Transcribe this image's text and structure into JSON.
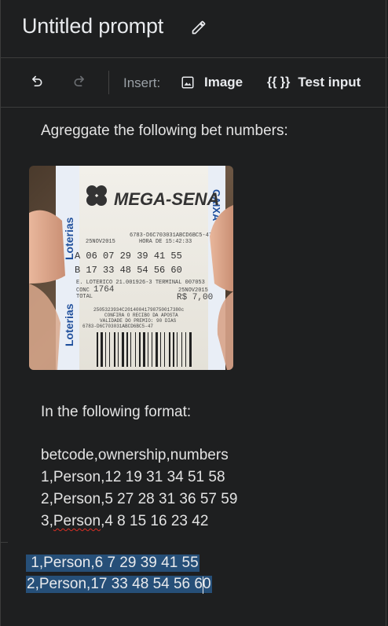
{
  "header": {
    "title": "Untitled prompt",
    "edit_icon": "pencil-icon"
  },
  "toolbar": {
    "undo_icon": "undo-icon",
    "redo_icon": "redo-icon",
    "insert_label": "Insert:",
    "image_label": "Image",
    "image_icon": "image-icon",
    "test_input_braces": "{{ }}",
    "test_input_label": "Test input"
  },
  "prompt": {
    "intro": "Agreggate the following bet numbers:",
    "format_intro": "In the following format:",
    "format_header": "betcode,ownership,numbers",
    "examples": [
      {
        "code": "1,",
        "owner": "Person",
        "rest": ",12 19 31 34 51 58"
      },
      {
        "code": "2,",
        "owner": "Person",
        "rest": ",5 27 28 31 36 57 59"
      },
      {
        "code": "3,",
        "owner": "Person",
        "rest": ",4 8 15 16 23 42"
      }
    ],
    "selected_lines": [
      " 1,Person,6 7 29 39 41 55",
      "2,Person,17 33 48 54 56 60"
    ]
  },
  "ticket": {
    "brand": "MEGA-SENA",
    "side_text": "Loterias",
    "caixa_text": "CAIXA",
    "date": "25NOV2015",
    "hour": "HORA DE 15:42:33",
    "serial": "6783-D6C703031ABCD6BC5-47",
    "line_a": "A  06 07 29 39 41 55",
    "line_b": "B  17 33 48 54 56 60",
    "lotterico": "E. LOTERICO 21.001926-3   TERMINAL 007053",
    "conc_label": "CONC",
    "conc_value": "1764",
    "date2": "25NOV2015",
    "total_label": "TOTAL",
    "total_value": "R$ 7,00",
    "barcode_num": "2505323934C20140041798750017380c",
    "confira": "CONFIRA O RECIBO DA APOSTA",
    "validade": "VALIDADE DO PREMIO: 90 DIAS",
    "serial2": "6783-D6C703031ABCD6BC5-47"
  }
}
